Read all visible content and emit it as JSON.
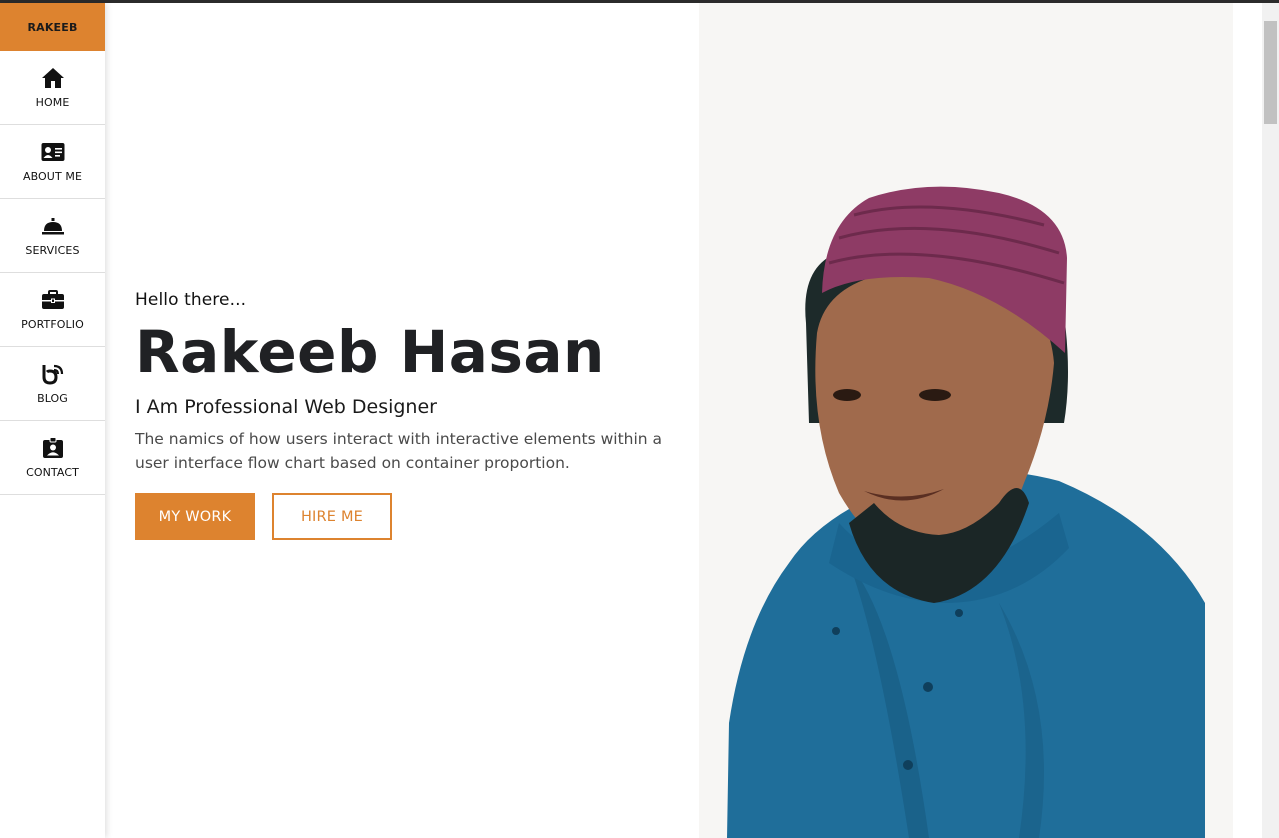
{
  "brand": {
    "name": "RAKEEB",
    "accent": "#dd832f"
  },
  "sidebar": {
    "items": [
      {
        "label": "HOME",
        "icon": "home-icon"
      },
      {
        "label": "ABOUT ME",
        "icon": "id-card-icon"
      },
      {
        "label": "SERVICES",
        "icon": "service-bell-icon"
      },
      {
        "label": "PORTFOLIO",
        "icon": "briefcase-icon"
      },
      {
        "label": "BLOG",
        "icon": "blog-icon"
      },
      {
        "label": "CONTACT",
        "icon": "contact-badge-icon"
      }
    ]
  },
  "hero": {
    "greeting": "Hello there...",
    "name": "Rakeeb Hasan",
    "role": "I Am Professional Web Designer",
    "description": "The namics of how users interact with interactive elements within a user interface flow chart based on container proportion.",
    "primary_button": "MY WORK",
    "secondary_button": "HIRE ME"
  },
  "portrait": {
    "subject": "person wearing maroon cap and blue kurta"
  }
}
